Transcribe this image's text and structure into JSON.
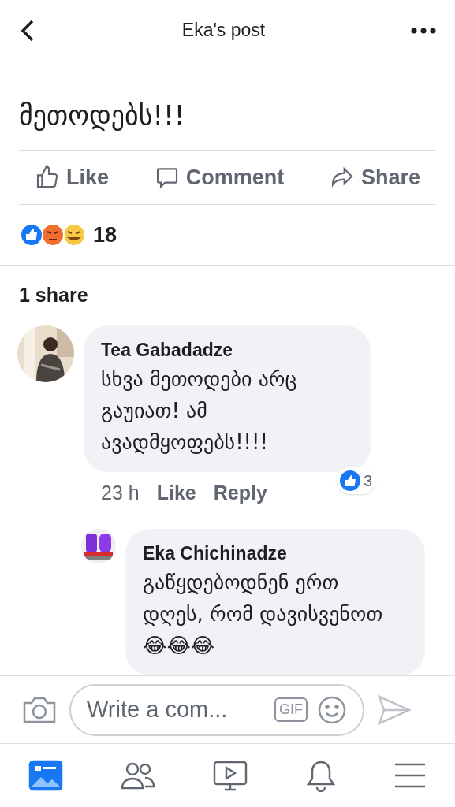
{
  "header": {
    "title": "Eka's post"
  },
  "post": {
    "text": "მეთოდებს!!!"
  },
  "actions": [
    {
      "kind": "like",
      "label": "Like"
    },
    {
      "kind": "comment",
      "label": "Comment"
    },
    {
      "kind": "share",
      "label": "Share"
    }
  ],
  "reactions": {
    "count": "18"
  },
  "shares": "1 share",
  "comments": [
    {
      "author": "Tea Gabadadze",
      "text": "სხვა მეთოდები არც გაუიათ! ამ ავადმყოფებს!!!!",
      "time": "23 h",
      "like": "Like",
      "reply": "Reply",
      "reaction_count": "3",
      "children": [
        {
          "author": "Eka Chichinadze",
          "text": "გაწყდებოდნენ ერთ დღეს, რომ დავისვენოთ 😂😂😂"
        }
      ]
    }
  ],
  "composer": {
    "placeholder": "Write a com...",
    "gif": "GIF"
  },
  "tabs": [
    {
      "kind": "feed",
      "selected": true
    },
    {
      "kind": "friends",
      "selected": false
    },
    {
      "kind": "watch",
      "selected": false
    },
    {
      "kind": "notifications",
      "selected": false
    },
    {
      "kind": "menu",
      "selected": false
    }
  ]
}
